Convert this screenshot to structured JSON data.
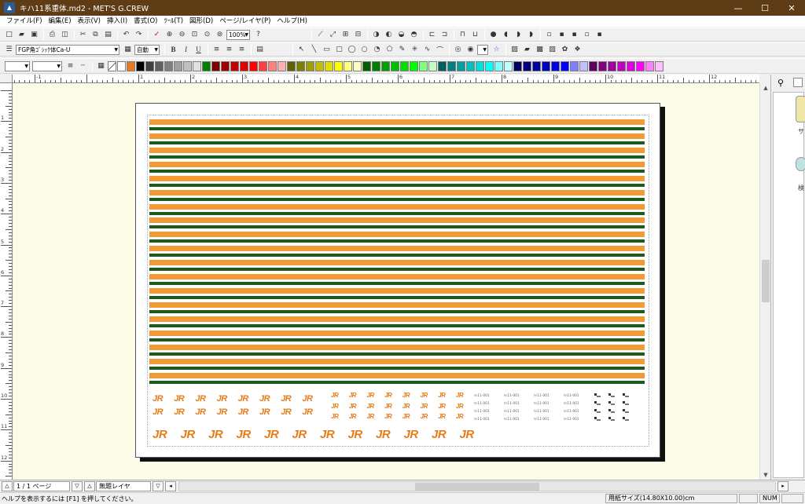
{
  "window": {
    "title": "キハ11系重体.md2 - MET'S G.CREW",
    "minimize": "—",
    "maximize": "☐",
    "close": "✕"
  },
  "menu": [
    "ファイル(F)",
    "編集(E)",
    "表示(V)",
    "挿入(I)",
    "書式(O)",
    "ﾂｰﾙ(T)",
    "図形(D)",
    "ページ/レイヤ(P)",
    "ヘルプ(H)"
  ],
  "toolbar": {
    "zoom": "100%",
    "font": "FGP角ｺﾞｼｯｸ体Ca-U",
    "font_size": "自動",
    "bold": "B",
    "italic": "I",
    "underline": "U"
  },
  "palette": [
    "#ffffff",
    "#e87a1e",
    "#000000",
    "#404040",
    "#606060",
    "#808080",
    "#a0a0a0",
    "#c0c0c0",
    "#e0e0e0",
    "#008000",
    "#800000",
    "#a00000",
    "#c00000",
    "#e00000",
    "#ff0000",
    "#ff4040",
    "#ff8080",
    "#ffb0b0",
    "#606000",
    "#808000",
    "#a0a000",
    "#c0c000",
    "#e0e000",
    "#ffff00",
    "#ffff80",
    "#ffffc0",
    "#006000",
    "#008000",
    "#00a000",
    "#00c000",
    "#00e000",
    "#00ff00",
    "#80ff80",
    "#c0ffc0",
    "#006060",
    "#008080",
    "#00a0a0",
    "#00c0c0",
    "#00e0e0",
    "#00ffff",
    "#80ffff",
    "#c0ffff",
    "#000060",
    "#000080",
    "#0000a0",
    "#0000c0",
    "#0000e0",
    "#0000ff",
    "#8080ff",
    "#c0c0ff",
    "#600060",
    "#800080",
    "#a000a0",
    "#c000c0",
    "#e000e0",
    "#ff00ff",
    "#ff80ff",
    "#ffc0ff"
  ],
  "rulers": {
    "h": [
      "-1",
      "1",
      "2",
      "3",
      "4",
      "5",
      "6",
      "7",
      "8",
      "9",
      "10",
      "11",
      "12",
      "13",
      "14",
      "15",
      "16",
      "17",
      "18"
    ],
    "v": [
      "1",
      "2",
      "3",
      "4",
      "5",
      "6",
      "7",
      "8",
      "9",
      "10",
      "11",
      "12",
      "13"
    ]
  },
  "decal": {
    "logo": "JR",
    "code_text": "ｷﾊ11-001"
  },
  "side_panel": {
    "label1": "サ",
    "label2": "検"
  },
  "pager": {
    "page": "1 / 1 ページ",
    "layer": "無題レイヤ"
  },
  "status": {
    "help": "ヘルプを表示するには [F1] を押してください。",
    "paper": "用紙サイズ(14.80X10.00)cm",
    "num": "NUM"
  }
}
